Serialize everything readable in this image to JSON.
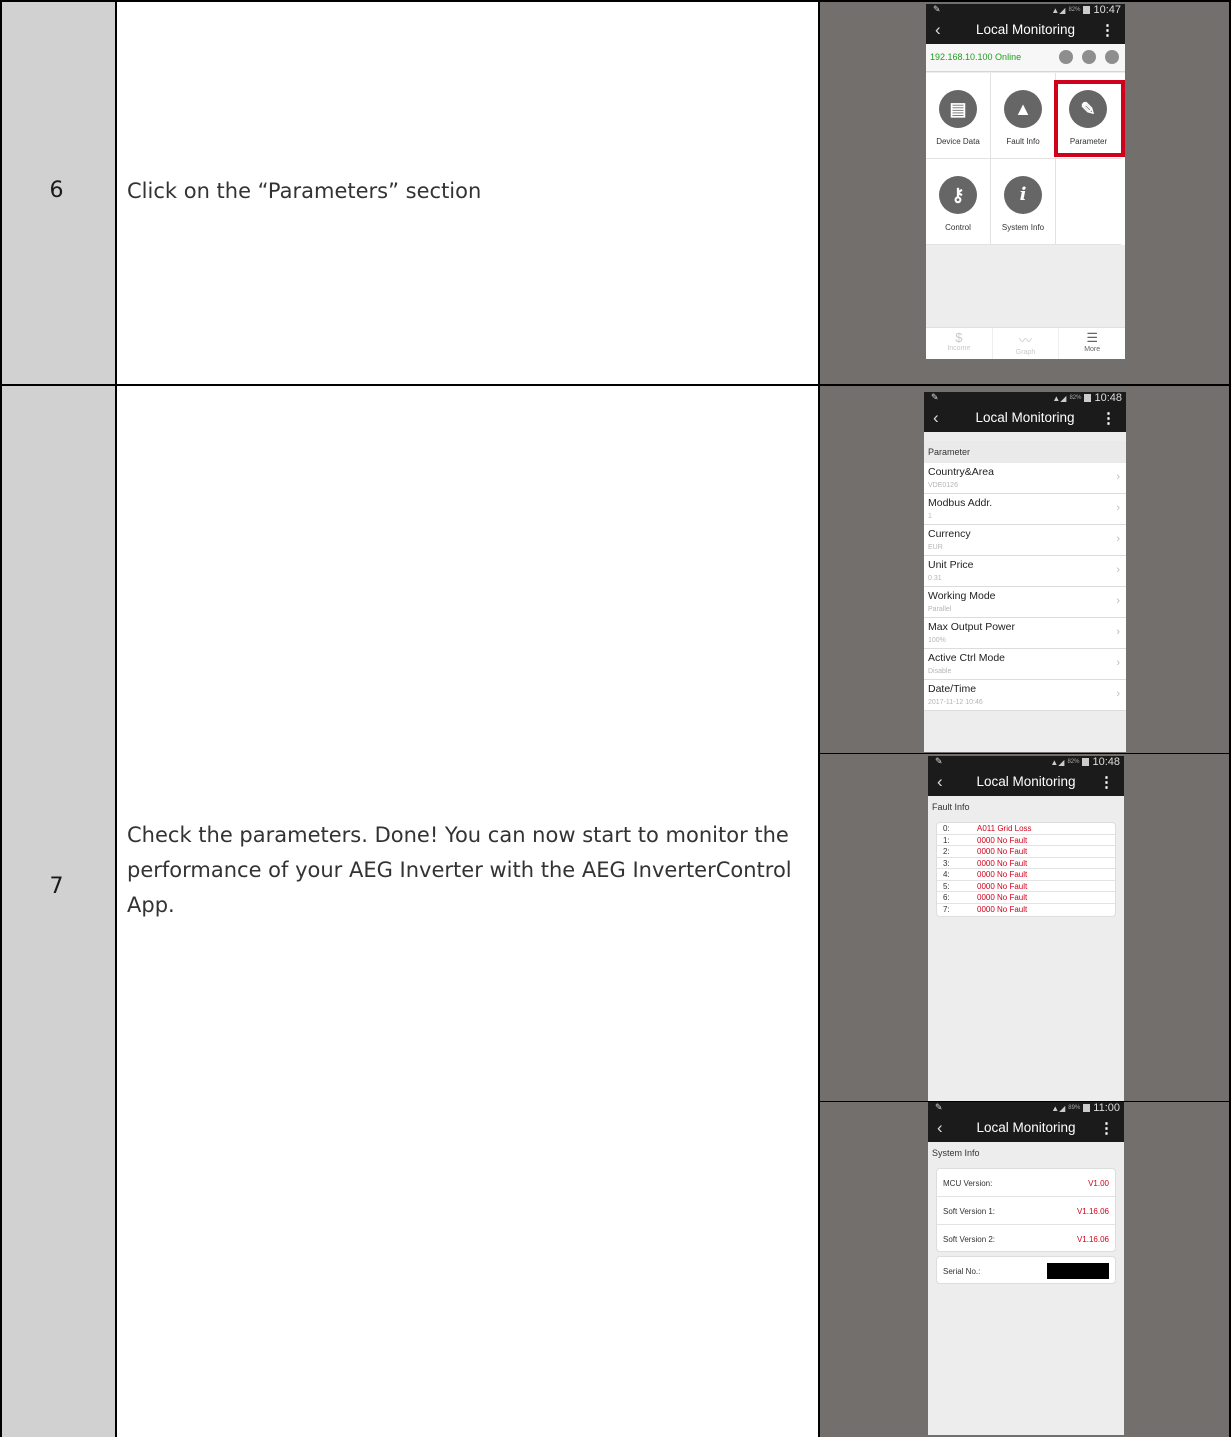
{
  "rows": [
    {
      "step": "6",
      "text": "Click on the “Parameters” section"
    },
    {
      "step": "7",
      "text": "Check the parameters. Done! You can now start to monitor the performance of your AEG Inverter with the AEG InverterControl App."
    }
  ],
  "screen1": {
    "status": {
      "signal": "82%",
      "time": "10:47"
    },
    "title": "Local Monitoring",
    "ip_status": "192.168.10.100 Online",
    "tiles": [
      {
        "label": "Device Data",
        "icon": "document-icon"
      },
      {
        "label": "Fault Info",
        "icon": "warning-icon"
      },
      {
        "label": "Parameter",
        "icon": "edit-icon"
      },
      {
        "label": "Control",
        "icon": "key-icon"
      },
      {
        "label": "System Info",
        "icon": "info-icon"
      }
    ],
    "tabs": [
      {
        "label": "Income",
        "icon": "$"
      },
      {
        "label": "Graph",
        "icon": "chart-icon"
      },
      {
        "label": "More",
        "icon": "menu-icon"
      }
    ],
    "highlight_color": "#d0021b"
  },
  "screen2": {
    "status": {
      "signal": "82%",
      "time": "10:48"
    },
    "title": "Local Monitoring",
    "section": "Parameter",
    "items": [
      {
        "label": "Country&Area",
        "value": "VDE0126"
      },
      {
        "label": "Modbus Addr.",
        "value": "1"
      },
      {
        "label": "Currency",
        "value": "EUR"
      },
      {
        "label": "Unit Price",
        "value": "0.31"
      },
      {
        "label": "Working Mode",
        "value": "Parallel"
      },
      {
        "label": "Max Output Power",
        "value": "100%"
      },
      {
        "label": "Active Ctrl Mode",
        "value": "Disable"
      },
      {
        "label": "Date/Time",
        "value": "2017-11-12 10:46"
      }
    ]
  },
  "screen3": {
    "status": {
      "signal": "82%",
      "time": "10:48"
    },
    "title": "Local Monitoring",
    "section": "Fault Info",
    "faults": [
      {
        "index": "0:",
        "code": "A011 Grid Loss"
      },
      {
        "index": "1:",
        "code": "0000 No Fault"
      },
      {
        "index": "2:",
        "code": "0000 No Fault"
      },
      {
        "index": "3:",
        "code": "0000 No Fault"
      },
      {
        "index": "4:",
        "code": "0000 No Fault"
      },
      {
        "index": "5:",
        "code": "0000 No Fault"
      },
      {
        "index": "6:",
        "code": "0000 No Fault"
      },
      {
        "index": "7:",
        "code": "0000 No Fault"
      }
    ]
  },
  "screen4": {
    "status": {
      "signal": "89%",
      "time": "11:00"
    },
    "title": "Local Monitoring",
    "section": "System Info",
    "versions": [
      {
        "label": "MCU Version:",
        "value": "V1.00"
      },
      {
        "label": "Soft Version 1:",
        "value": "V1.16.06"
      },
      {
        "label": "Soft Version 2:",
        "value": "V1.16.06"
      }
    ],
    "serial_label": "Serial No.:"
  }
}
